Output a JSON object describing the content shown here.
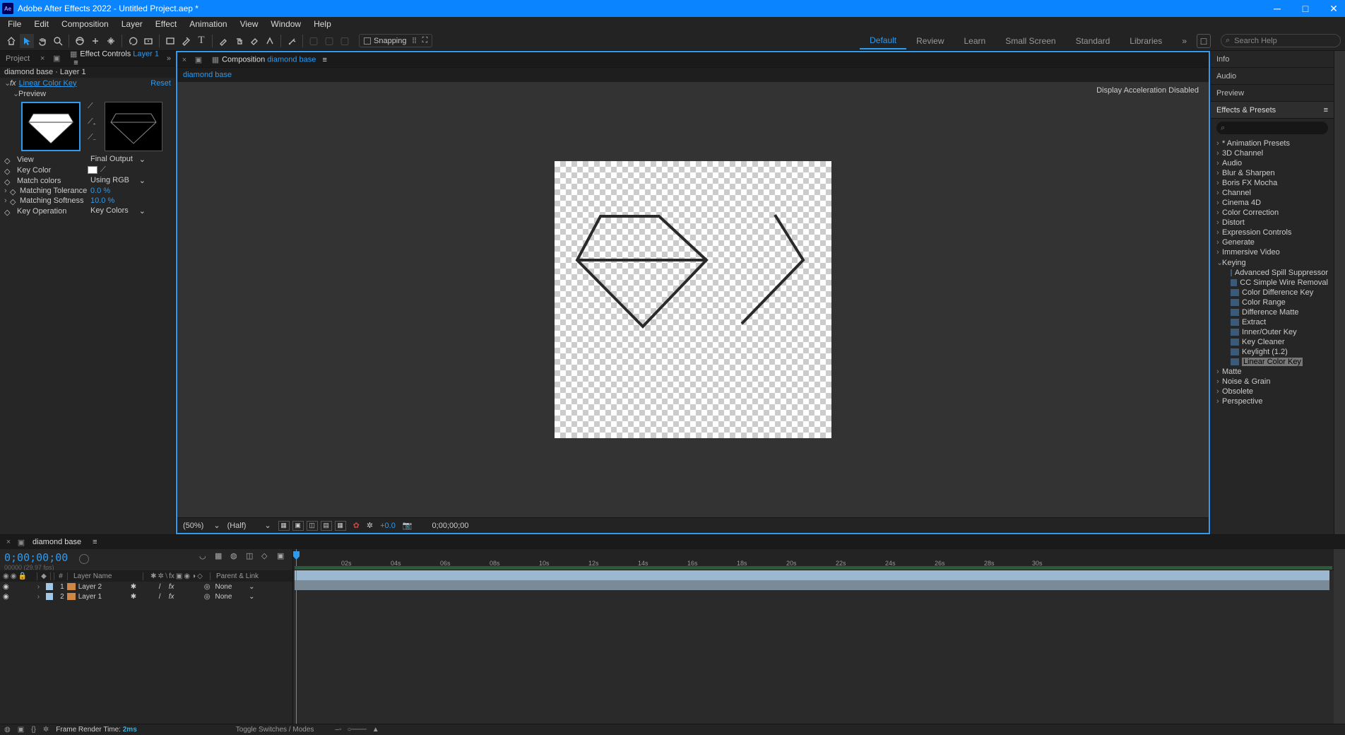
{
  "titlebar": {
    "app": "Adobe After Effects 2022 - Untitled Project.aep *"
  },
  "menu": [
    "File",
    "Edit",
    "Composition",
    "Layer",
    "Effect",
    "Animation",
    "View",
    "Window",
    "Help"
  ],
  "toolbar": {
    "snapping": "Snapping"
  },
  "workspaces": {
    "items": [
      "Default",
      "Review",
      "Learn",
      "Small Screen",
      "Standard",
      "Libraries"
    ],
    "search_placeholder": "Search Help"
  },
  "left": {
    "project_tab": "Project",
    "ec_tab_prefix": "Effect Controls ",
    "ec_tab_layer": "Layer 1",
    "breadcrumb": "diamond base · Layer 1",
    "effect": {
      "fx_prefix": "fx",
      "name": "Linear Color Key",
      "reset": "Reset",
      "preview_label": "Preview",
      "props": {
        "view_label": "View",
        "view_value": "Final Output",
        "keycolor_label": "Key Color",
        "match_label": "Match colors",
        "match_value": "Using RGB",
        "tol_label": "Matching Tolerance",
        "tol_value": "0.0 %",
        "soft_label": "Matching Softness",
        "soft_value": "10.0 %",
        "op_label": "Key Operation",
        "op_value": "Key Colors"
      }
    }
  },
  "center": {
    "tab_prefix": "Composition ",
    "comp_name": "diamond base",
    "accel_msg": "Display Acceleration Disabled",
    "zoom": "(50%)",
    "res": "(Half)",
    "exposure": "+0.0",
    "timecode": "0;00;00;00"
  },
  "right": {
    "info": "Info",
    "audio": "Audio",
    "preview": "Preview",
    "ep": "Effects & Presets",
    "categories": [
      "* Animation Presets",
      "3D Channel",
      "Audio",
      "Blur & Sharpen",
      "Boris FX Mocha",
      "Channel",
      "Cinema 4D",
      "Color Correction",
      "Distort",
      "Expression Controls",
      "Generate",
      "Immersive Video"
    ],
    "keying_label": "Keying",
    "keying_items": [
      "Advanced Spill Suppressor",
      "CC Simple Wire Removal",
      "Color Difference Key",
      "Color Range",
      "Difference Matte",
      "Extract",
      "Inner/Outer Key",
      "Key Cleaner",
      "Keylight (1.2)",
      "Linear Color Key"
    ],
    "after_keying": [
      "Matte",
      "Noise & Grain",
      "Obsolete",
      "Perspective"
    ]
  },
  "timeline": {
    "comp_name": "diamond base",
    "timecode": "0;00;00;00",
    "timecode_sub": "00000 (29.97 fps)",
    "labels": {
      "hash": "#",
      "layername": "Layer Name",
      "parent": "Parent & Link"
    },
    "layers": [
      {
        "num": "1",
        "name": "Layer 2",
        "parent": "None"
      },
      {
        "num": "2",
        "name": "Layer 1",
        "parent": "None"
      }
    ],
    "ticks": [
      "02s",
      "04s",
      "06s",
      "08s",
      "10s",
      "12s",
      "14s",
      "16s",
      "18s",
      "20s",
      "22s",
      "24s",
      "26s",
      "28s",
      "30s"
    ]
  },
  "status": {
    "render_prefix": "Frame Render Time: ",
    "render_time": "2ms",
    "toggle": "Toggle Switches / Modes"
  }
}
